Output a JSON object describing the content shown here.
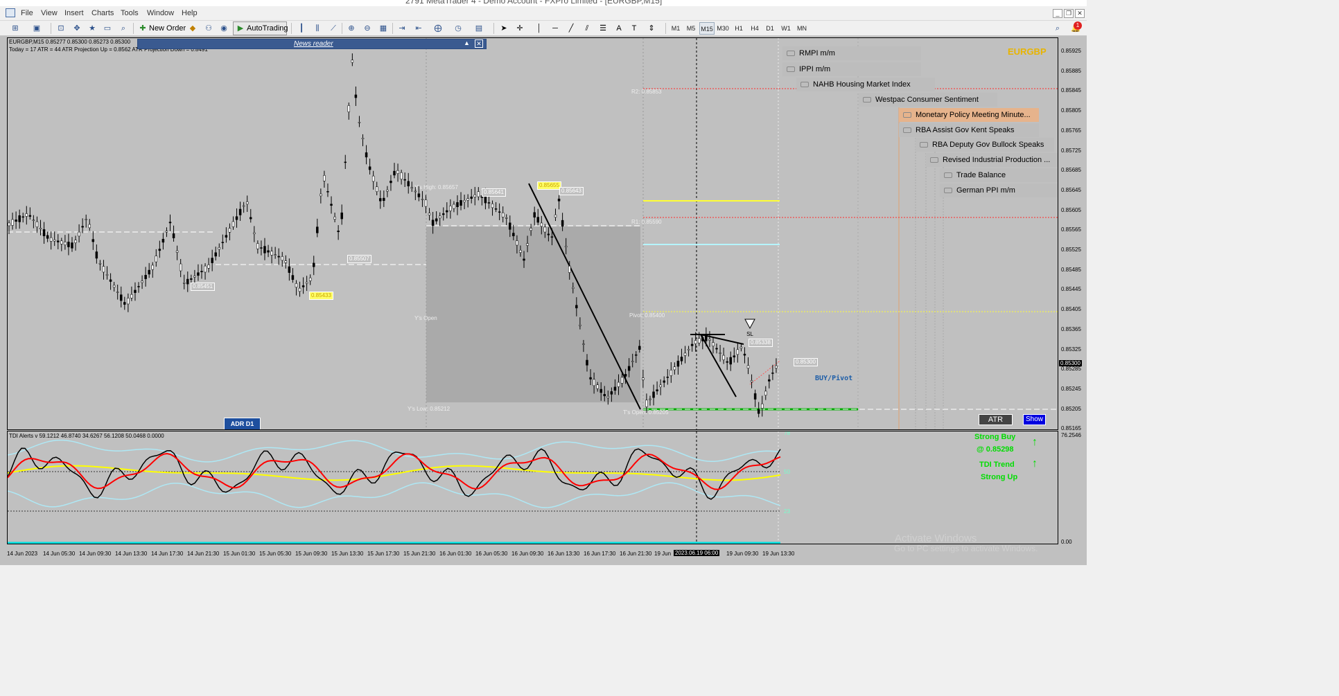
{
  "window": {
    "title": "2791 MetaTrader 4 - Demo Account - FXPro Limited - [EURGBP,M15]"
  },
  "menu": [
    "File",
    "View",
    "Insert",
    "Charts",
    "Tools",
    "Window",
    "Help"
  ],
  "toolbar": {
    "new_order": "New Order",
    "autotrading": "AutoTrading",
    "timeframes": [
      "M1",
      "M5",
      "M15",
      "M30",
      "H1",
      "H4",
      "D1",
      "W1",
      "MN"
    ],
    "active_tf": "M15",
    "notification_count": "1"
  },
  "chart": {
    "info_line1": "EURGBP,M15  0.85277 0.85300 0.85273 0.85300",
    "info_line2": "Today = 17    ATR = 44    ATR Projection Up = 0.8562    ATR Projection Down = 0.8491",
    "symbol_label": "EURGBP",
    "news_reader_label": "News reader",
    "news": [
      "RMPI m/m",
      "IPPI m/m",
      "NAHB Housing Market Index",
      "Westpac Consumer Sentiment",
      "Monetary Policy Meeting Minute...",
      "RBA Assist Gov Kent Speaks",
      "RBA Deputy Gov Bullock Speaks",
      "Revised Industrial Production ...",
      "Trade Balance",
      "German PPI m/m"
    ],
    "levels": {
      "r2": "R2: 0.85853",
      "r1": "R1: 0.85590",
      "pivot": "Pivot: 0.85400",
      "ys_high": "Y's High: 0.85657",
      "ys_open": "Y's Open",
      "ys_low": "Y's Low: 0.85212",
      "ts_open": "T's Open: 0.85205"
    },
    "price_labels": {
      "p1": "0.85451",
      "p2": "0.85433",
      "p3": "0.85507",
      "p4": "0.85655",
      "p5": "0.85643",
      "p6": "0.85641",
      "p7": "0.85338",
      "p8": "0.85300"
    },
    "buy_pivot": "BUY/Pivot",
    "adr_button": "ADR D1",
    "atr_button": "ATR",
    "show_button": "Show",
    "sl_marker": "SL"
  },
  "indicator": {
    "title": "TDI Alerts v 59.1212 46.8740 34.6267 56.1208 50.0468 0.0000",
    "levels": [
      "78",
      "50",
      "23"
    ],
    "strong_buy": "Strong Buy",
    "strong_buy_price": "@ 0.85298",
    "tdi_trend": "TDI Trend",
    "tdi_trend_value": "Strong Up",
    "axis_top": "76.2546",
    "axis_bottom": "0.00"
  },
  "price_axis": [
    "0.85925",
    "0.85885",
    "0.85845",
    "0.85805",
    "0.85765",
    "0.85725",
    "0.85685",
    "0.85645",
    "0.85605",
    "0.85565",
    "0.85525",
    "0.85485",
    "0.85445",
    "0.85405",
    "0.85365",
    "0.85325",
    "0.85300",
    "0.85285",
    "0.85245",
    "0.85205",
    "0.85165"
  ],
  "current_price": "0.85300",
  "time_axis": [
    "14 Jun 2023",
    "14 Jun 05:30",
    "14 Jun 09:30",
    "14 Jun 13:30",
    "14 Jun 17:30",
    "14 Jun 21:30",
    "15 Jun 01:30",
    "15 Jun 05:30",
    "15 Jun 09:30",
    "15 Jun 13:30",
    "15 Jun 17:30",
    "15 Jun 21:30",
    "16 Jun 01:30",
    "16 Jun 05:30",
    "16 Jun 09:30",
    "16 Jun 13:30",
    "16 Jun 17:30",
    "16 Jun 21:30",
    "19 Jun",
    "2023.06.19 06:00",
    "19 Jun 09:30",
    "19 Jun 13:30"
  ],
  "watermark": {
    "line1": "Activate Windows",
    "line2": "Go to PC settings to activate Windows."
  },
  "colors": {
    "chart_bg": "#c0c0c0",
    "r_line": "#ff2a2a",
    "yellow_line": "#ffff33",
    "cyan_line": "#b5f5ff",
    "green_line": "#00aa00",
    "tdi_red": "#ff0000",
    "tdi_yellow": "#ffff00",
    "tdi_band": "#aee8f5",
    "buy_green": "#00dd00",
    "news_highlight": "#e6b38c"
  }
}
